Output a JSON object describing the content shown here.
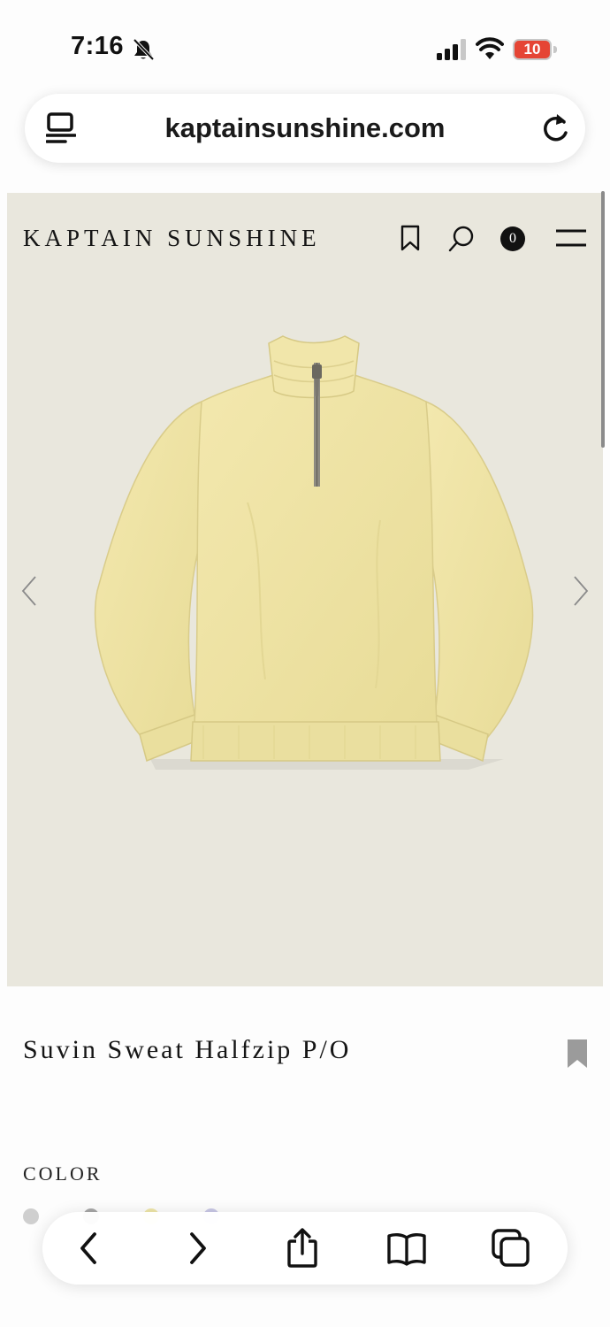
{
  "status_bar": {
    "time": "7:16",
    "battery_level": "10",
    "battery_fraction": 0.1,
    "battery_color": "#e54535"
  },
  "browser": {
    "url": "kaptainsunshine.com",
    "icons": [
      "reader-icon",
      "reload-icon"
    ]
  },
  "site_header": {
    "brand": "KAPTAIN SUNSHINE",
    "cart_count": "0",
    "icons": [
      "bookmark-icon",
      "search-icon",
      "menu-icon"
    ]
  },
  "product": {
    "title": "Suvin Sweat Halfzip P/O",
    "image": "yellow-halfzip-sweatshirt",
    "image_background": "#e9e7dd",
    "garment_color": "#efe3a4"
  },
  "options": {
    "color_label": "COLOR",
    "swatches": [
      "#cfcfcf",
      "#a7a7a7",
      "#efe6a8",
      "#c9c8e6"
    ]
  },
  "toolbar": {
    "icons": [
      "back-icon",
      "forward-icon",
      "share-icon",
      "bookmarks-icon",
      "tabs-icon"
    ]
  }
}
